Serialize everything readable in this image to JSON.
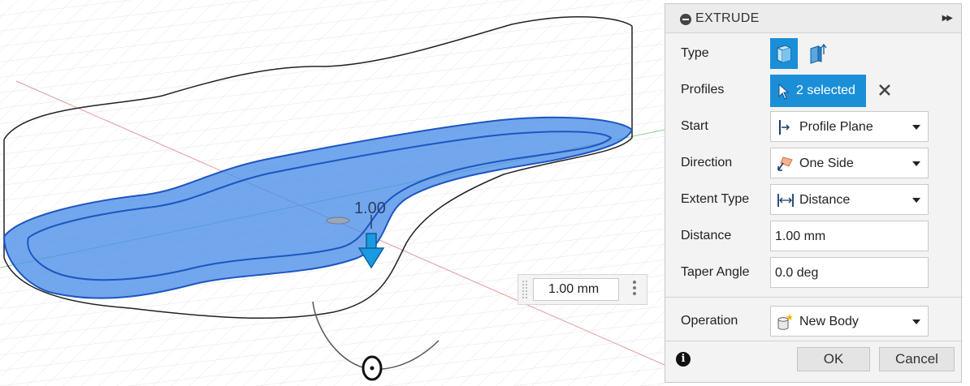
{
  "viewport": {
    "dimension_label": "1.00",
    "distance_input": "1.00 mm"
  },
  "panel": {
    "title": "EXTRUDE",
    "rows": {
      "type": {
        "label": "Type"
      },
      "profiles": {
        "label": "Profiles",
        "value": "2 selected"
      },
      "start": {
        "label": "Start",
        "value": "Profile Plane"
      },
      "direction": {
        "label": "Direction",
        "value": "One Side"
      },
      "extent_type": {
        "label": "Extent Type",
        "value": "Distance"
      },
      "distance": {
        "label": "Distance",
        "value": "1.00 mm"
      },
      "taper_angle": {
        "label": "Taper Angle",
        "value": "0.0 deg"
      },
      "operation": {
        "label": "Operation",
        "value": "New Body"
      }
    },
    "ok_label": "OK",
    "cancel_label": "Cancel"
  },
  "colors": {
    "accent": "#1a8fd8",
    "profile_fill": "#4a8ee8",
    "profile_stroke": "#1d56c0",
    "grid": "#dedede",
    "x_axis": "#e07070",
    "y_axis": "#7cc87c"
  }
}
